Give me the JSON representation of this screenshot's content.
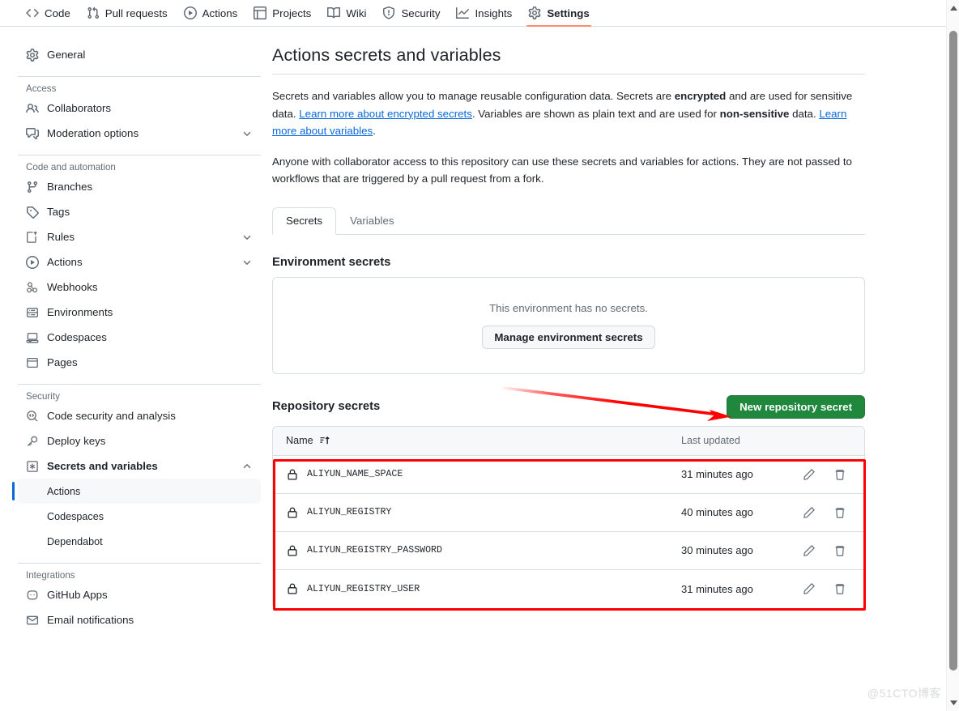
{
  "topnav": {
    "items": [
      {
        "label": "Code",
        "icon": "code-icon",
        "active": false
      },
      {
        "label": "Pull requests",
        "icon": "git-pull-request-icon",
        "active": false
      },
      {
        "label": "Actions",
        "icon": "play-circle-icon",
        "active": false
      },
      {
        "label": "Projects",
        "icon": "table-icon",
        "active": false
      },
      {
        "label": "Wiki",
        "icon": "book-icon",
        "active": false
      },
      {
        "label": "Security",
        "icon": "shield-icon",
        "active": false
      },
      {
        "label": "Insights",
        "icon": "graph-icon",
        "active": false
      },
      {
        "label": "Settings",
        "icon": "gear-icon",
        "active": true
      }
    ]
  },
  "sidebar": {
    "general": {
      "label": "General",
      "icon": "gear-icon"
    },
    "groups": [
      {
        "title": "Access",
        "items": [
          {
            "label": "Collaborators",
            "icon": "people-icon",
            "chevron": null
          },
          {
            "label": "Moderation options",
            "icon": "comment-discussion-icon",
            "chevron": "down"
          }
        ]
      },
      {
        "title": "Code and automation",
        "items": [
          {
            "label": "Branches",
            "icon": "git-branch-icon",
            "chevron": null
          },
          {
            "label": "Tags",
            "icon": "tag-icon",
            "chevron": null
          },
          {
            "label": "Rules",
            "icon": "rules-icon",
            "chevron": "down"
          },
          {
            "label": "Actions",
            "icon": "play-circle-icon",
            "chevron": "down"
          },
          {
            "label": "Webhooks",
            "icon": "webhook-icon",
            "chevron": null
          },
          {
            "label": "Environments",
            "icon": "server-icon",
            "chevron": null
          },
          {
            "label": "Codespaces",
            "icon": "codespaces-icon",
            "chevron": null
          },
          {
            "label": "Pages",
            "icon": "browser-icon",
            "chevron": null
          }
        ]
      },
      {
        "title": "Security",
        "items": [
          {
            "label": "Code security and analysis",
            "icon": "code-scan-icon",
            "chevron": null
          },
          {
            "label": "Deploy keys",
            "icon": "key-icon",
            "chevron": null
          },
          {
            "label": "Secrets and variables",
            "icon": "asterisk-icon",
            "chevron": "up",
            "bold": true
          }
        ],
        "subitems": [
          {
            "label": "Actions",
            "selected": true
          },
          {
            "label": "Codespaces",
            "selected": false
          },
          {
            "label": "Dependabot",
            "selected": false
          }
        ]
      },
      {
        "title": "Integrations",
        "items": [
          {
            "label": "GitHub Apps",
            "icon": "apps-icon",
            "chevron": null
          },
          {
            "label": "Email notifications",
            "icon": "mail-icon",
            "chevron": null
          }
        ]
      }
    ]
  },
  "main": {
    "title": "Actions secrets and variables",
    "intro": {
      "p1_a": "Secrets and variables allow you to manage reusable configuration data. Secrets are ",
      "p1_b": "encrypted",
      "p1_c": " and are used for sensitive data. ",
      "link1": "Learn more about encrypted secrets",
      "p1_d": ". Variables are shown as plain text and are used for ",
      "p1_e": "non-sensitive",
      "p1_f": " data. ",
      "link2": "Learn more about variables",
      "p1_g": ".",
      "p2": "Anyone with collaborator access to this repository can use these secrets and variables for actions. They are not passed to workflows that are triggered by a pull request from a fork."
    },
    "tabs": [
      {
        "label": "Secrets",
        "active": true
      },
      {
        "label": "Variables",
        "active": false
      }
    ],
    "environment_secrets": {
      "heading": "Environment secrets",
      "empty_text": "This environment has no secrets.",
      "manage_button": "Manage environment secrets"
    },
    "repository_secrets": {
      "heading": "Repository secrets",
      "new_button": "New repository secret",
      "columns": {
        "name": "Name",
        "last_updated": "Last updated"
      },
      "sort_icon": "sort-asc-icon",
      "rows": [
        {
          "name": "ALIYUN_NAME_SPACE",
          "updated": "31 minutes ago",
          "lock_icon": "lock-icon",
          "edit_icon": "pencil-icon",
          "delete_icon": "trash-icon"
        },
        {
          "name": "ALIYUN_REGISTRY",
          "updated": "40 minutes ago",
          "lock_icon": "lock-icon",
          "edit_icon": "pencil-icon",
          "delete_icon": "trash-icon"
        },
        {
          "name": "ALIYUN_REGISTRY_PASSWORD",
          "updated": "30 minutes ago",
          "lock_icon": "lock-icon",
          "edit_icon": "pencil-icon",
          "delete_icon": "trash-icon"
        },
        {
          "name": "ALIYUN_REGISTRY_USER",
          "updated": "31 minutes ago",
          "lock_icon": "lock-icon",
          "edit_icon": "pencil-icon",
          "delete_icon": "trash-icon"
        }
      ]
    }
  },
  "annotations": {
    "arrow_color": "#ff0000",
    "box_color": "#ff0000"
  },
  "watermark": {
    "text": "@51CTO博客"
  },
  "colors": {
    "accent_green": "#1f883d",
    "link_blue": "#0969da",
    "active_tab_underline": "#fd8c73",
    "border": "#d8dee4",
    "muted_text": "#636c76"
  }
}
